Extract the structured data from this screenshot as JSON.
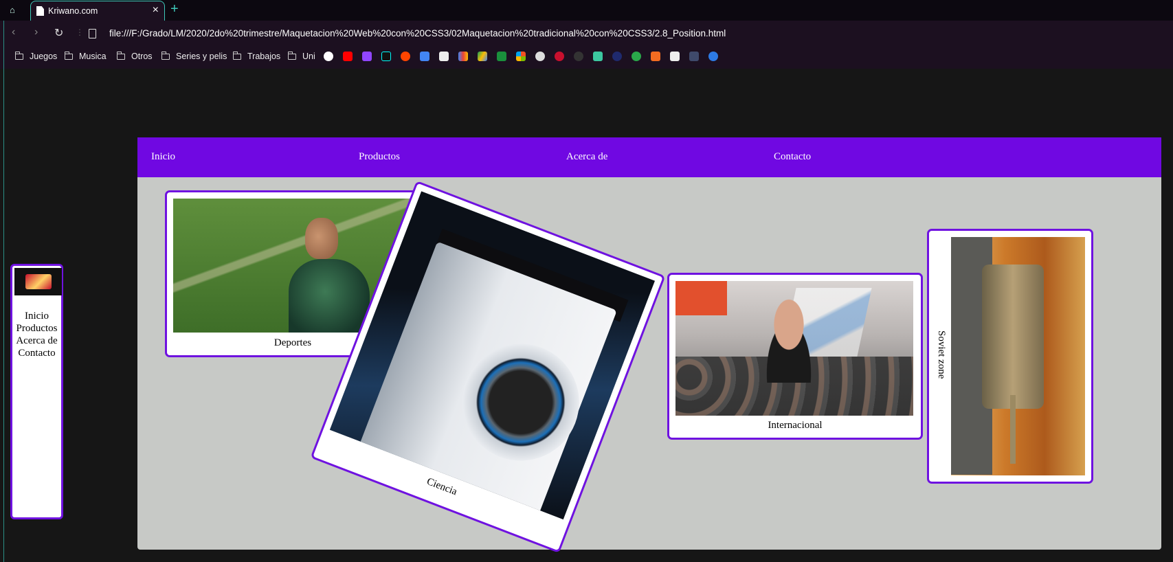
{
  "browser": {
    "tab_title": "Kriwano.com",
    "url": "file:///F:/Grado/LM/2020/2do%20trimestre/Maquetacion%20Web%20con%20CSS3/02Maquetacion%20tradicional%20con%20CSS3/2.8_Position.html",
    "bookmark_folders": [
      "Juegos",
      "Musica",
      "Otros",
      "Series y pelis",
      "Trabajos",
      "Uni"
    ]
  },
  "top_menu": {
    "items": [
      "Inicio",
      "Productos",
      "Acerca de",
      "Contacto"
    ]
  },
  "sidebar": {
    "items": [
      "Inicio",
      "Productos",
      "Acerca de",
      "Contacto"
    ]
  },
  "cards": {
    "deportes": "Deportes",
    "ciencia": "Ciencia",
    "internacional": "Internacional",
    "soviet": "Soviet zone"
  },
  "colors": {
    "accent": "#7008e2",
    "content_bg": "#c7c9c6",
    "page_bg": "#161616",
    "tab_accent": "#3ec9b9"
  }
}
